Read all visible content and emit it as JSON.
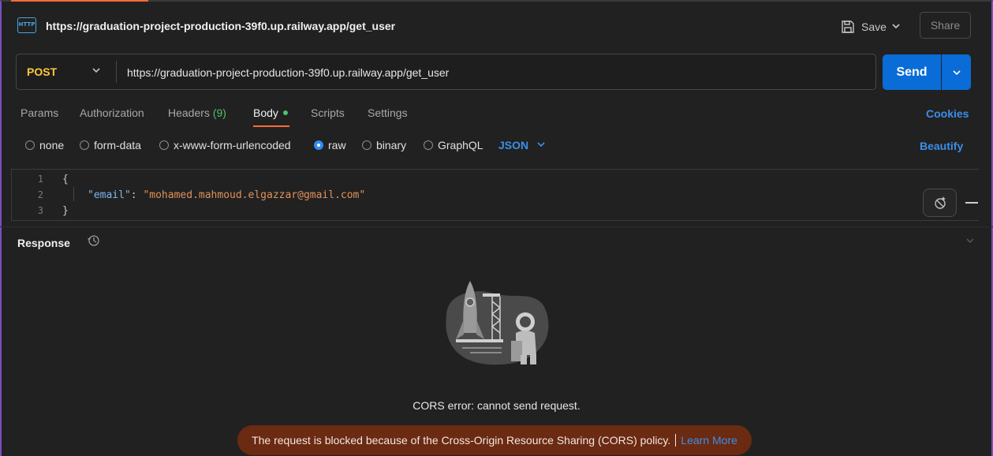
{
  "header": {
    "method_icon_text": "HTTP",
    "title_url": "https://graduation-project-production-39f0.up.railway.app/get_user",
    "save_label": "Save",
    "share_label": "Share"
  },
  "request": {
    "method": "POST",
    "url": "https://graduation-project-production-39f0.up.railway.app/get_user",
    "send_label": "Send"
  },
  "tabs": [
    {
      "label": "Params"
    },
    {
      "label": "Authorization"
    },
    {
      "label": "Headers",
      "count": "(9)"
    },
    {
      "label": "Body",
      "active": true
    },
    {
      "label": "Scripts"
    },
    {
      "label": "Settings"
    }
  ],
  "cookies_label": "Cookies",
  "body_types": [
    {
      "label": "none",
      "selected": false
    },
    {
      "label": "form-data",
      "selected": false
    },
    {
      "label": "x-www-form-urlencoded",
      "selected": false
    },
    {
      "label": "raw",
      "selected": true
    },
    {
      "label": "binary",
      "selected": false
    },
    {
      "label": "GraphQL",
      "selected": false
    }
  ],
  "raw_format": "JSON",
  "beautify_label": "Beautify",
  "editor": {
    "lines": [
      {
        "num": "1",
        "text": "{"
      },
      {
        "num": "2",
        "key": "\"email\"",
        "colon": ": ",
        "value": "\"mohamed.mahmoud.elgazzar@gmail.com\""
      },
      {
        "num": "3",
        "text": "}"
      }
    ]
  },
  "response": {
    "title": "Response",
    "error_title": "CORS error: cannot send request.",
    "banner_text": "The request is blocked because of the Cross-Origin Resource Sharing (CORS) policy.",
    "banner_link": "Learn More"
  },
  "colors": {
    "accent_orange": "#ff6c37",
    "send_blue": "#0a6cd6",
    "link_blue": "#3b8fe8",
    "method_yellow": "#ffc93c",
    "banner_bg": "#6b2a12"
  }
}
